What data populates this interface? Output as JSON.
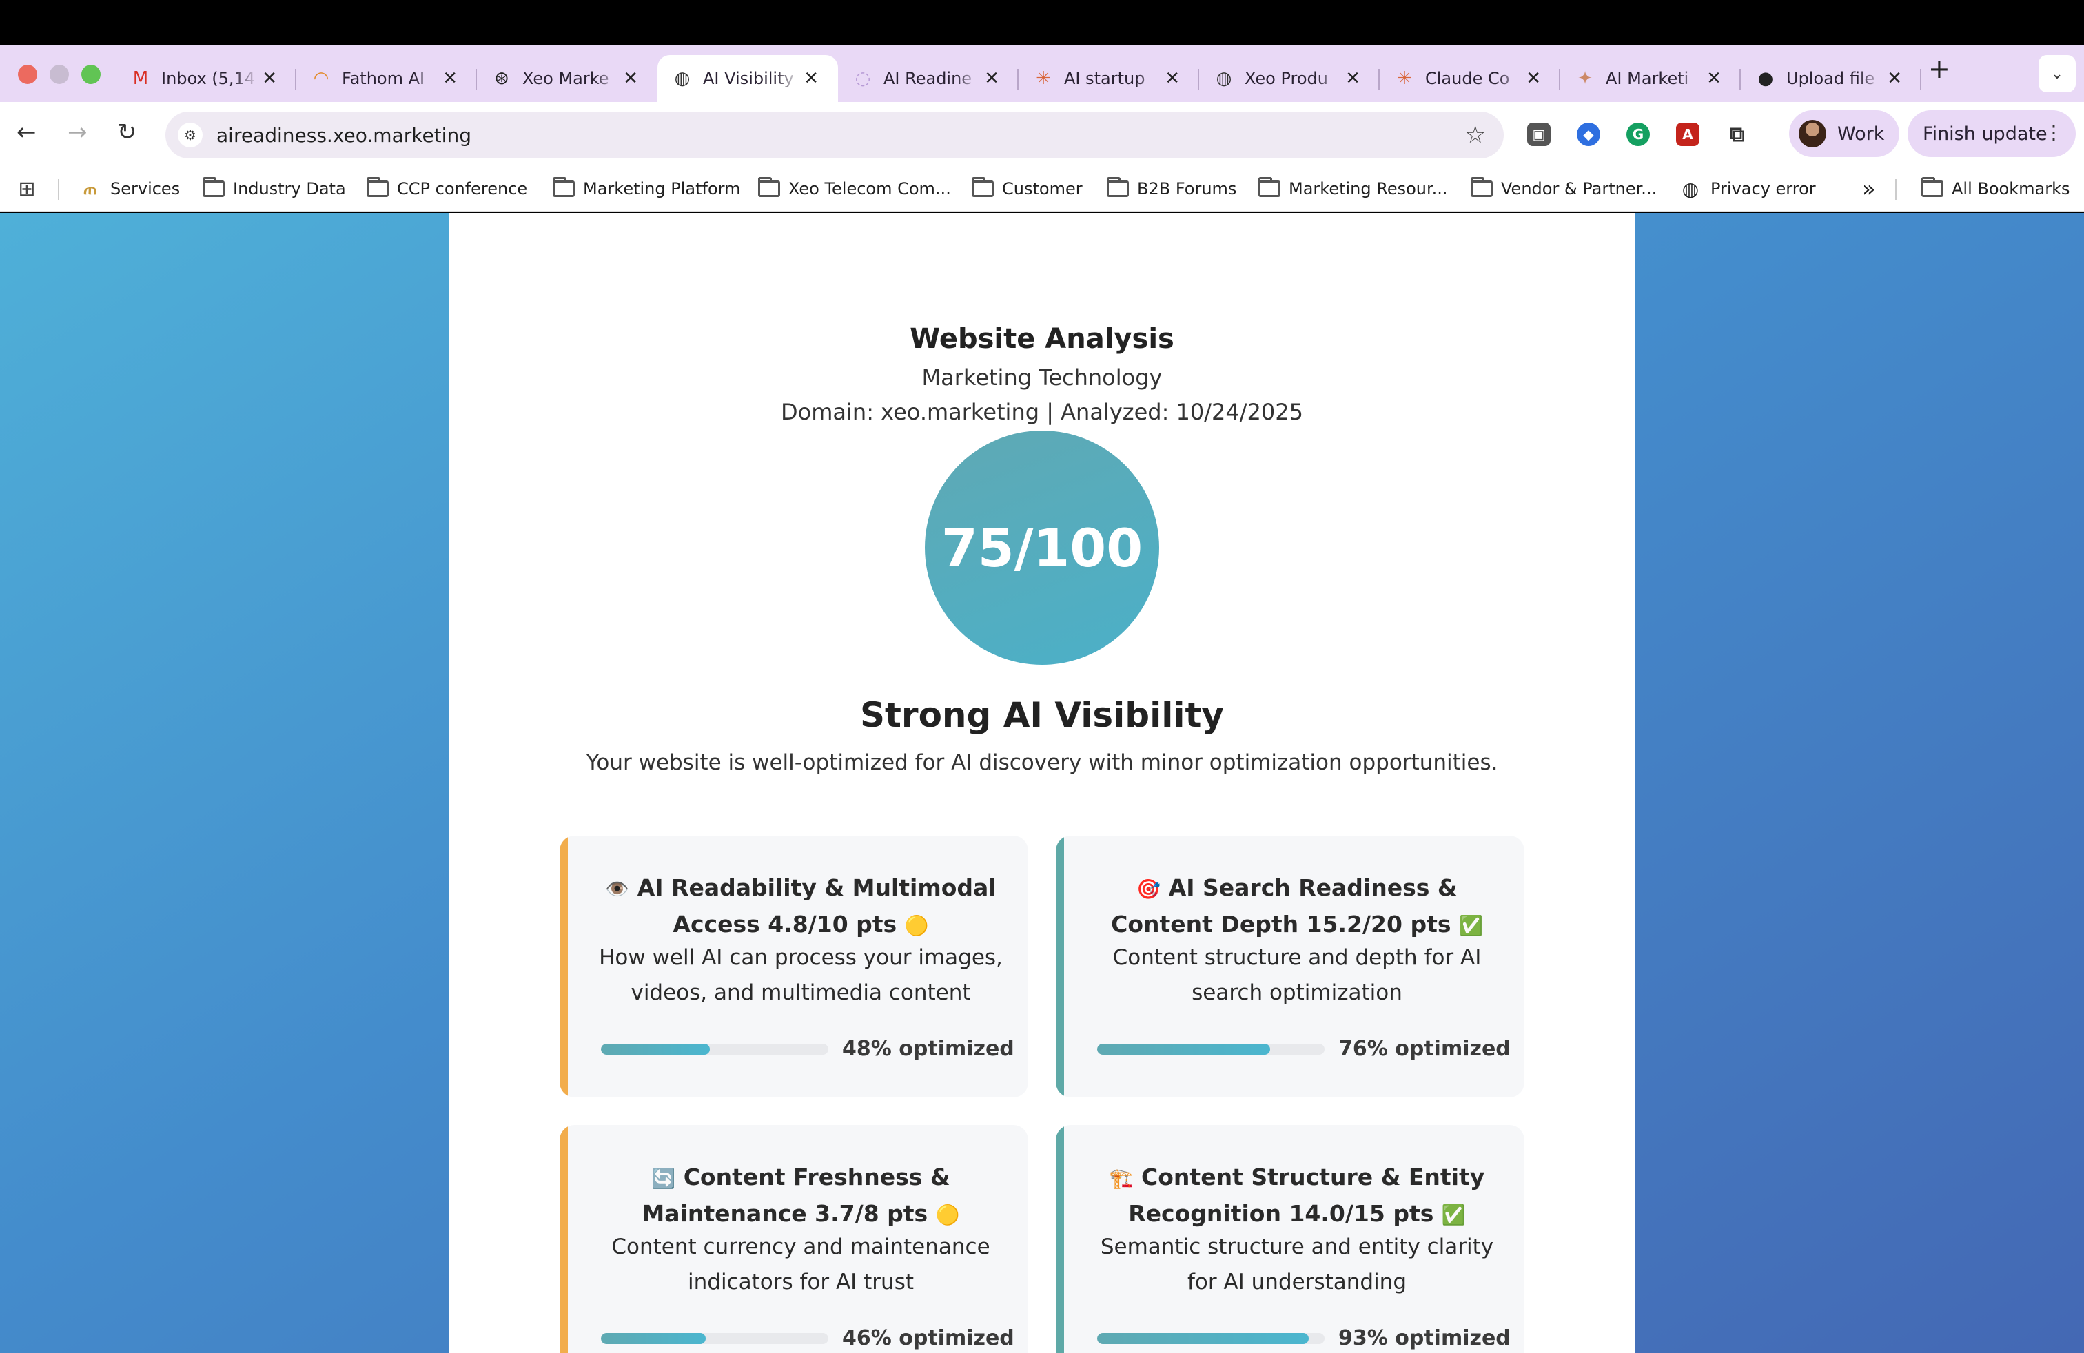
{
  "browser": {
    "tabs": [
      {
        "title": "Inbox (5,14",
        "icon": "gmail-icon",
        "glyph": "M",
        "color": "#d93025"
      },
      {
        "title": "Fathom AI",
        "icon": "rainbow-icon",
        "glyph": "◠",
        "color": "#e28b2b"
      },
      {
        "title": "Xeo Marke",
        "icon": "openai-icon",
        "glyph": "⊛",
        "color": "#222"
      },
      {
        "title": "AI Visibility",
        "icon": "globe-icon",
        "glyph": "◍",
        "color": "#333"
      },
      {
        "title": "AI Readine",
        "icon": "spinner-icon",
        "glyph": "◌",
        "color": "#b79bd6"
      },
      {
        "title": "AI startup",
        "icon": "claude-icon",
        "glyph": "✳",
        "color": "#d9663b"
      },
      {
        "title": "Xeo Produ",
        "icon": "globe-icon",
        "glyph": "◍",
        "color": "#333"
      },
      {
        "title": "Claude Co",
        "icon": "claude-icon",
        "glyph": "✳",
        "color": "#d9663b"
      },
      {
        "title": "AI Marketi",
        "icon": "star-icon",
        "glyph": "✦",
        "color": "#c86"
      },
      {
        "title": "Upload file",
        "icon": "github-icon",
        "glyph": "●",
        "color": "#222"
      }
    ],
    "active_tab_index": 3,
    "address": "aireadiness.xeo.marketing",
    "profile_label": "Work",
    "update_label": "Finish update",
    "bookmarks": [
      {
        "label": "Services",
        "type": "favicon"
      },
      {
        "label": "Industry Data",
        "type": "folder"
      },
      {
        "label": "CCP conference",
        "type": "folder"
      },
      {
        "label": "Marketing Platform",
        "type": "folder"
      },
      {
        "label": "Xeo Telecom Com...",
        "type": "folder"
      },
      {
        "label": "Customer",
        "type": "folder"
      },
      {
        "label": "B2B Forums",
        "type": "folder"
      },
      {
        "label": "Marketing Resour...",
        "type": "folder"
      },
      {
        "label": "Vendor & Partner...",
        "type": "folder"
      },
      {
        "label": "Privacy error",
        "type": "globe"
      }
    ],
    "all_bookmarks_label": "All Bookmarks",
    "overflow_label": "»"
  },
  "report": {
    "title": "Website Analysis",
    "industry": "Marketing Technology",
    "meta": "Domain: xeo.marketing | Analyzed: 10/24/2025",
    "score": "75/100",
    "verdict": "Strong AI Visibility",
    "verdict_desc": "Your website is well-optimized for AI discovery with minor optimization opportunities.",
    "metrics": [
      {
        "emoji": "👁️",
        "title": "AI Readability & Multimodal Access 4.8/10 pts",
        "status_emoji": "🟡",
        "desc": "How well AI can process your images, videos, and multimedia content",
        "progress": 48,
        "progress_label": "48% optimized",
        "accent": "#f2ad4c"
      },
      {
        "emoji": "🎯",
        "title": "AI Search Readiness & Content Depth 15.2/20 pts",
        "status_emoji": "✅",
        "desc": "Content structure and depth for AI search optimization",
        "progress": 76,
        "progress_label": "76% optimized",
        "accent": "#5ea9a7"
      },
      {
        "emoji": "🔄",
        "title": "Content Freshness & Maintenance 3.7/8 pts",
        "status_emoji": "🟡",
        "desc": "Content currency and maintenance indicators for AI trust",
        "progress": 46,
        "progress_label": "46% optimized",
        "accent": "#f2ad4c"
      },
      {
        "emoji": "🏗️",
        "title": "Content Structure & Entity Recognition 14.0/15 pts",
        "status_emoji": "✅",
        "desc": "Semantic structure and entity clarity for AI understanding",
        "progress": 93,
        "progress_label": "93% optimized",
        "accent": "#5ea9a7"
      }
    ]
  }
}
